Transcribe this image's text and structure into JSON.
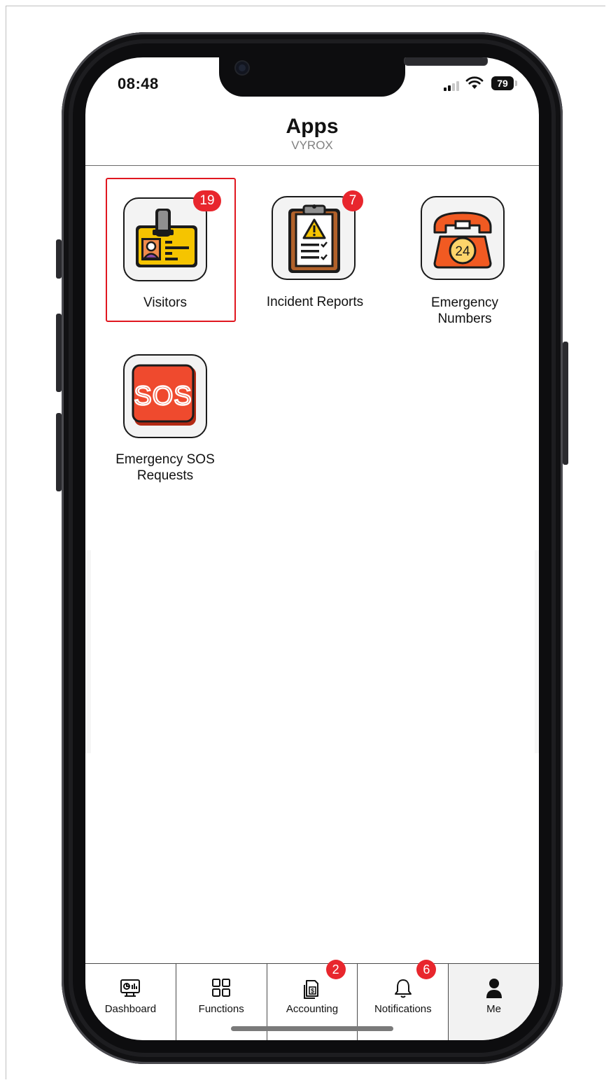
{
  "status_bar": {
    "time": "08:48",
    "battery": "79"
  },
  "header": {
    "title": "Apps",
    "subtitle": "VYROX"
  },
  "apps": [
    {
      "label": "Visitors",
      "badge": "19",
      "icon": "id-badge-icon",
      "selected": true
    },
    {
      "label": "Incident Reports",
      "badge": "7",
      "icon": "clipboard-warning-icon"
    },
    {
      "label_line1": "Emergency",
      "label_line2": "Numbers",
      "icon": "phone-24-icon"
    },
    {
      "label_line1": "Emergency SOS",
      "label_line2": "Requests",
      "icon": "sos-icon",
      "icon_text": "SOS"
    }
  ],
  "tabbar": {
    "items": [
      {
        "label": "Dashboard",
        "icon": "dashboard-icon"
      },
      {
        "label": "Functions",
        "icon": "grid-icon"
      },
      {
        "label": "Accounting",
        "icon": "invoice-icon",
        "badge": "2"
      },
      {
        "label": "Notifications",
        "icon": "bell-icon",
        "badge": "6"
      },
      {
        "label": "Me",
        "icon": "user-icon",
        "active": true
      }
    ]
  },
  "colors": {
    "badge": "#e8262d",
    "selection": "#e0171f"
  }
}
